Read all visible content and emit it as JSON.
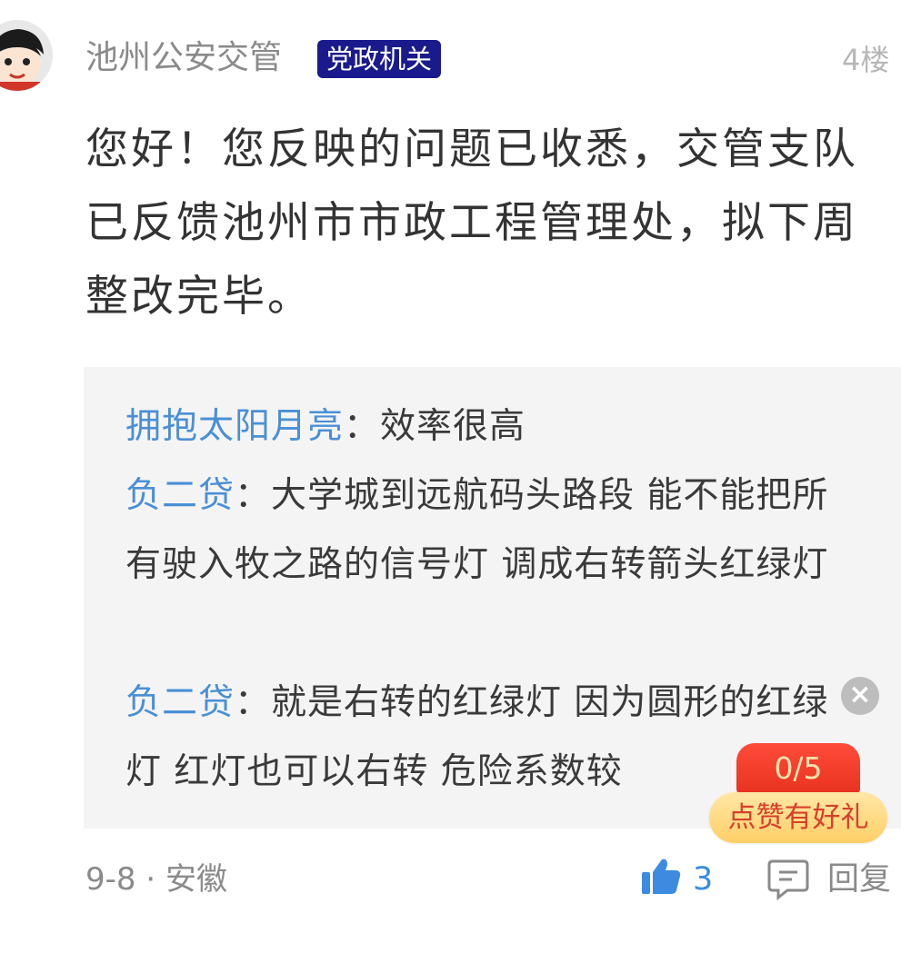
{
  "comment": {
    "author": "池州公安交管",
    "badge": "党政机关",
    "floor": "4楼",
    "text": "您好！您反映的问题已收悉，交管支队已反馈池州市市政工程管理处，拟下周整改完毕。",
    "date_location": "9-8 · 安徽",
    "likes": "3",
    "reply_label": "回复"
  },
  "sub_replies": [
    {
      "user": "拥抱太阳月亮",
      "sep": "：",
      "text": "效率很高"
    },
    {
      "user": "负二贷",
      "sep": "：",
      "text": "大学城到远航码头路段 能不能把所有驶入牧之路的信号灯 调成右转箭头红绿灯"
    },
    {
      "user": "负二贷",
      "sep": "：",
      "text": "就是右转的红绿灯 因为圆形的红绿灯 红灯也可以右转 危险系数较"
    }
  ],
  "promo": {
    "count": "0/5",
    "label": "点赞有好礼"
  },
  "icons": {
    "avatar": "avatar-face",
    "close": "close-icon",
    "like": "thumbs-up-icon",
    "reply": "comment-icon"
  },
  "colors": {
    "badge_bg": "#1a1a8c",
    "username_link": "#4a8fd6",
    "like_blue": "#3c8be0",
    "promo_red": "#e8321f",
    "promo_yellow": "#ffcf67"
  }
}
